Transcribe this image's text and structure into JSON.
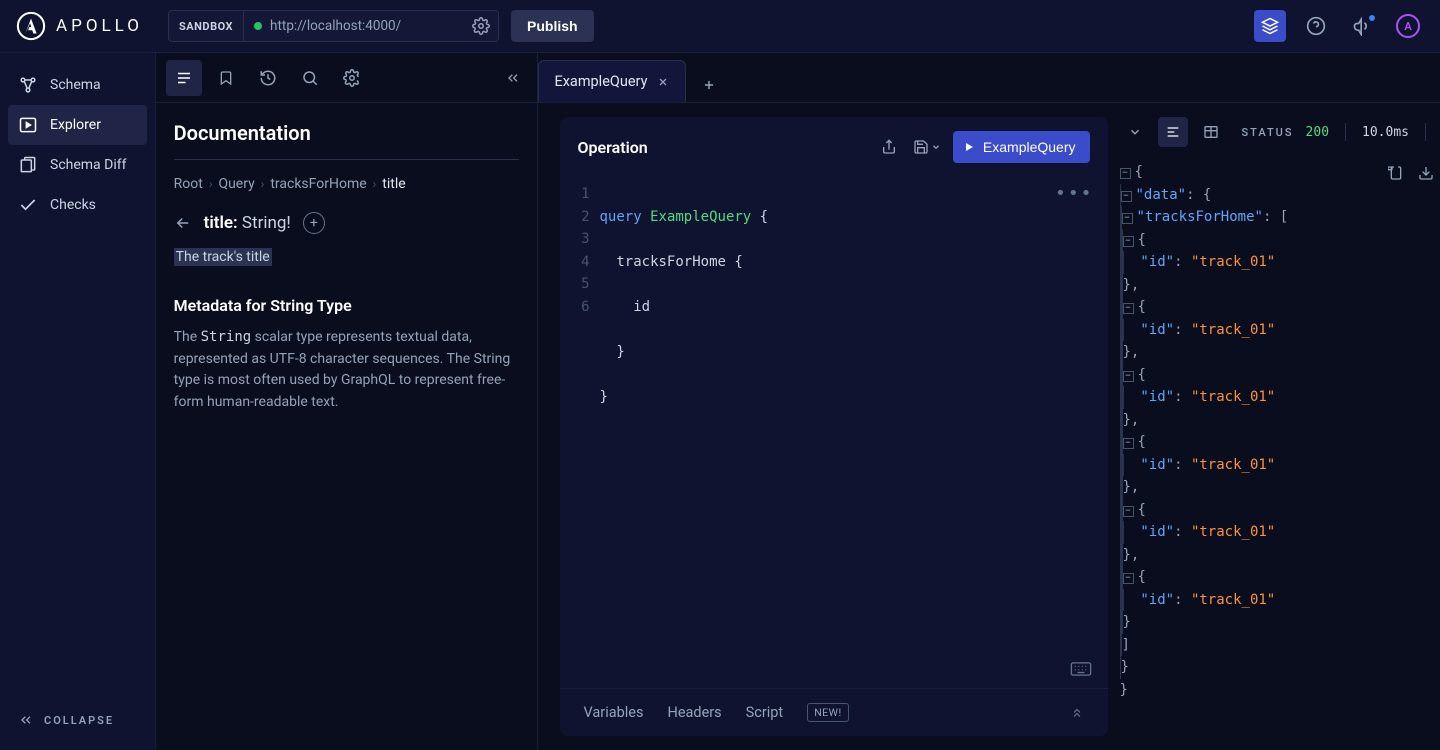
{
  "brand": {
    "name": "APOLLO"
  },
  "topbar": {
    "sandbox_label": "SANDBOX",
    "url": "http://localhost:4000/",
    "publish_label": "Publish",
    "avatar_initial": "A"
  },
  "sidebar": {
    "items": [
      {
        "label": "Schema"
      },
      {
        "label": "Explorer"
      },
      {
        "label": "Schema Diff"
      },
      {
        "label": "Checks"
      }
    ],
    "collapse_label": "COLLAPSE"
  },
  "docs": {
    "title": "Documentation",
    "breadcrumb": [
      "Root",
      "Query",
      "tracksForHome",
      "title"
    ],
    "field": {
      "name": "title:",
      "type": "String!"
    },
    "field_description": "The track's title",
    "metadata_heading": "Metadata for String Type",
    "metadata_body_pre": "The ",
    "metadata_body_code": "String",
    "metadata_body_post": " scalar type represents textual data, represented as UTF-8 character sequences. The String type is most often used by GraphQL to represent free-form human-readable text."
  },
  "tabs": {
    "active": "ExampleQuery"
  },
  "operation": {
    "title": "Operation",
    "run_label": "ExampleQuery",
    "code": {
      "lines": [
        "1",
        "2",
        "3",
        "4",
        "5",
        "6"
      ],
      "l1_kw": "query",
      "l1_name": "ExampleQuery",
      "l1_brace": " {",
      "l2": "  tracksForHome {",
      "l3": "    id",
      "l4": "  }",
      "l5": "}"
    },
    "bottom_tabs": {
      "variables": "Variables",
      "headers": "Headers",
      "script": "Script",
      "new_badge": "NEW!"
    }
  },
  "response": {
    "status_label": "STATUS",
    "status_code": "200",
    "timing": "10.0ms",
    "json": {
      "data_key": "\"data\"",
      "tracks_key": "\"tracksForHome\"",
      "id_key": "\"id\"",
      "id_val": "\"track_01\"",
      "count": 6
    }
  }
}
